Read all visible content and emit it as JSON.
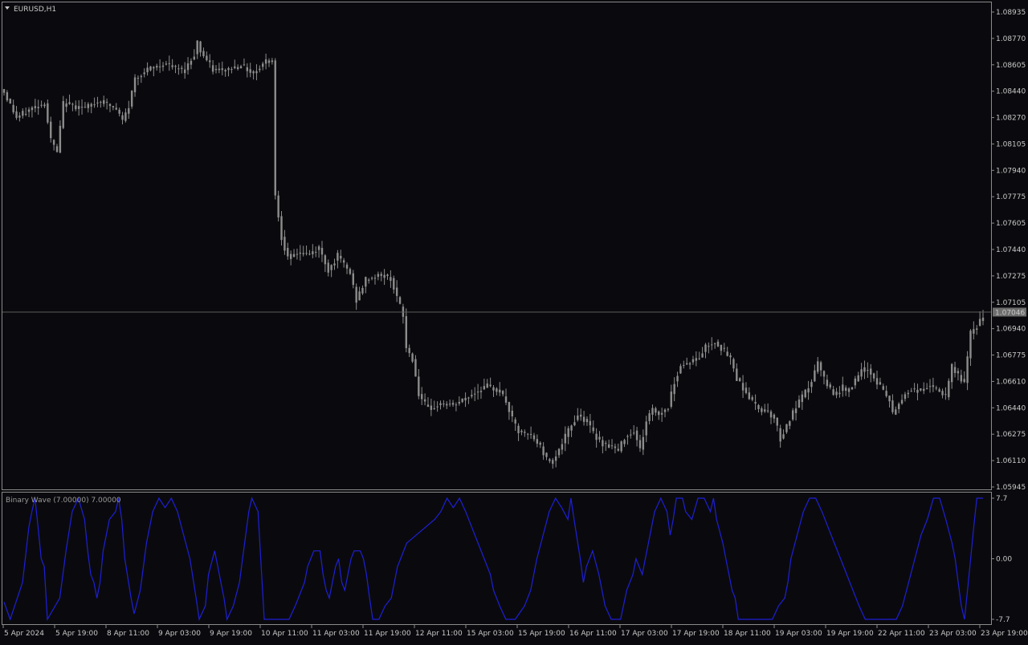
{
  "symbol": "EURUSD,H1",
  "colors": {
    "background": "#0a0a0e",
    "frame": "#8a8a8a",
    "candle": "#8c8c8c",
    "current_price_line": "#5a5a5a",
    "indicator_line": "#1f1fd8",
    "price_tag_bg": "#6e6e6e",
    "price_tag_text": "#0a0a0e"
  },
  "price_axis": {
    "ticks": [
      "1.08935",
      "1.08770",
      "1.08605",
      "1.08440",
      "1.08270",
      "1.08105",
      "1.07940",
      "1.07775",
      "1.07605",
      "1.07440",
      "1.07275",
      "1.07105",
      "1.06940",
      "1.06775",
      "1.06610",
      "1.06440",
      "1.06275",
      "1.06110",
      "1.05945"
    ],
    "range": [
      1.05945,
      1.08935
    ],
    "current_price": "1.07046"
  },
  "indicator": {
    "label": "Binary Wave (7.00000) 7.00000",
    "ticks": [
      "7.7",
      "0.00",
      "-7.7"
    ],
    "range": [
      -7.7,
      7.7
    ]
  },
  "time_axis": {
    "labels": [
      "5 Apr 2024",
      "5 Apr 19:00",
      "8 Apr 11:00",
      "9 Apr 03:00",
      "9 Apr 19:00",
      "10 Apr 11:00",
      "11 Apr 03:00",
      "11 Apr 19:00",
      "12 Apr 11:00",
      "15 Apr 03:00",
      "15 Apr 19:00",
      "16 Apr 11:00",
      "17 Apr 03:00",
      "17 Apr 19:00",
      "18 Apr 11:00",
      "19 Apr 03:00",
      "19 Apr 19:00",
      "22 Apr 11:00",
      "23 Apr 03:00",
      "23 Apr 19:00"
    ]
  },
  "chart_data": [
    {
      "type": "candlestick",
      "title": "EURUSD,H1",
      "ylim": [
        1.05945,
        1.08935
      ],
      "close_path": [
        [
          0,
          1.0843
        ],
        [
          4,
          1.0827
        ],
        [
          9,
          1.0833
        ],
        [
          13,
          1.0836
        ],
        [
          15,
          1.0813
        ],
        [
          17,
          1.0805
        ],
        [
          19,
          1.0836
        ],
        [
          26,
          1.0833
        ],
        [
          31,
          1.0838
        ],
        [
          36,
          1.0832
        ],
        [
          38,
          1.0825
        ],
        [
          40,
          1.0834
        ],
        [
          42,
          1.0852
        ],
        [
          47,
          1.0858
        ],
        [
          52,
          1.0861
        ],
        [
          55,
          1.0858
        ],
        [
          58,
          1.0857
        ],
        [
          61,
          1.0867
        ],
        [
          62,
          1.0875
        ],
        [
          63,
          1.0869
        ],
        [
          67,
          1.0857
        ],
        [
          71,
          1.0857
        ],
        [
          76,
          1.086
        ],
        [
          80,
          1.0855
        ],
        [
          84,
          1.0863
        ],
        [
          86,
          1.0863
        ],
        [
          87,
          1.0778
        ],
        [
          89,
          1.0752
        ],
        [
          91,
          1.0738
        ],
        [
          94,
          1.0742
        ],
        [
          98,
          1.0741
        ],
        [
          101,
          1.0745
        ],
        [
          104,
          1.0731
        ],
        [
          107,
          1.074
        ],
        [
          111,
          1.0729
        ],
        [
          113,
          1.0712
        ],
        [
          116,
          1.0725
        ],
        [
          121,
          1.0728
        ],
        [
          124,
          1.0726
        ],
        [
          126,
          1.0714
        ],
        [
          128,
          1.0702
        ],
        [
          129,
          1.0682
        ],
        [
          131,
          1.0675
        ],
        [
          133,
          1.0653
        ],
        [
          136,
          1.0643
        ],
        [
          140,
          1.0647
        ],
        [
          144,
          1.0646
        ],
        [
          147,
          1.0649
        ],
        [
          151,
          1.0654
        ],
        [
          155,
          1.0658
        ],
        [
          159,
          1.0655
        ],
        [
          161,
          1.0648
        ],
        [
          163,
          1.0637
        ],
        [
          165,
          1.0629
        ],
        [
          169,
          1.0627
        ],
        [
          172,
          1.062
        ],
        [
          174,
          1.0612
        ],
        [
          176,
          1.0611
        ],
        [
          178,
          1.0618
        ],
        [
          181,
          1.063
        ],
        [
          184,
          1.064
        ],
        [
          187,
          1.0636
        ],
        [
          189,
          1.0628
        ],
        [
          192,
          1.0622
        ],
        [
          195,
          1.062
        ],
        [
          197,
          1.0617
        ],
        [
          199,
          1.0626
        ],
        [
          202,
          1.063
        ],
        [
          204,
          1.0618
        ],
        [
          206,
          1.0636
        ],
        [
          208,
          1.0644
        ],
        [
          210,
          1.064
        ],
        [
          213,
          1.0645
        ],
        [
          215,
          1.0661
        ],
        [
          217,
          1.0671
        ],
        [
          220,
          1.0673
        ],
        [
          223,
          1.0676
        ],
        [
          225,
          1.0683
        ],
        [
          228,
          1.0686
        ],
        [
          230,
          1.0682
        ],
        [
          233,
          1.0675
        ],
        [
          235,
          1.0663
        ],
        [
          238,
          1.0654
        ],
        [
          240,
          1.0648
        ],
        [
          242,
          1.0644
        ],
        [
          245,
          1.0642
        ],
        [
          247,
          1.0638
        ],
        [
          249,
          1.0625
        ],
        [
          251,
          1.0633
        ],
        [
          253,
          1.0641
        ],
        [
          255,
          1.0648
        ],
        [
          257,
          1.0654
        ],
        [
          259,
          1.0661
        ],
        [
          261,
          1.0673
        ],
        [
          263,
          1.0662
        ],
        [
          265,
          1.0656
        ],
        [
          267,
          1.0653
        ],
        [
          269,
          1.0657
        ],
        [
          271,
          1.0656
        ],
        [
          273,
          1.0661
        ],
        [
          275,
          1.0667
        ],
        [
          277,
          1.0669
        ],
        [
          279,
          1.0663
        ],
        [
          281,
          1.0658
        ],
        [
          284,
          1.0649
        ],
        [
          285,
          1.064
        ],
        [
          287,
          1.0647
        ],
        [
          289,
          1.0653
        ],
        [
          291,
          1.0656
        ],
        [
          294,
          1.0655
        ],
        [
          296,
          1.0658
        ],
        [
          298,
          1.0657
        ],
        [
          300,
          1.0655
        ],
        [
          302,
          1.0651
        ],
        [
          304,
          1.067
        ],
        [
          306,
          1.0665
        ],
        [
          308,
          1.066
        ],
        [
          310,
          1.0691
        ],
        [
          312,
          1.0696
        ],
        [
          314,
          1.0702
        ]
      ]
    },
    {
      "type": "line",
      "title": "Binary Wave (7.00000) 7.00000",
      "ylim": [
        -7.7,
        7.7
      ],
      "points": [
        [
          0,
          -5.5
        ],
        [
          2,
          -7.7
        ],
        [
          6,
          -3
        ],
        [
          8,
          4
        ],
        [
          9,
          6
        ],
        [
          10,
          7.7
        ],
        [
          11,
          4
        ],
        [
          12,
          0
        ],
        [
          13,
          -1
        ],
        [
          14,
          -7.7
        ],
        [
          18,
          -5
        ],
        [
          20,
          1
        ],
        [
          22,
          6
        ],
        [
          24,
          7.7
        ],
        [
          26,
          5
        ],
        [
          27,
          1
        ],
        [
          28,
          -2
        ],
        [
          29,
          -3
        ],
        [
          30,
          -5
        ],
        [
          31,
          -3
        ],
        [
          32,
          1
        ],
        [
          34,
          5
        ],
        [
          36,
          6
        ],
        [
          37,
          7.7
        ],
        [
          38,
          5
        ],
        [
          39,
          0
        ],
        [
          41,
          -5
        ],
        [
          42,
          -7
        ],
        [
          44,
          -4
        ],
        [
          46,
          2
        ],
        [
          48,
          6
        ],
        [
          50,
          7.7
        ],
        [
          52,
          6.5
        ],
        [
          54,
          7.7
        ],
        [
          56,
          6
        ],
        [
          58,
          3
        ],
        [
          60,
          0
        ],
        [
          62,
          -5
        ],
        [
          63,
          -7.7
        ],
        [
          65,
          -6
        ],
        [
          66,
          -2
        ],
        [
          68,
          1
        ],
        [
          69,
          -1
        ],
        [
          70,
          -3
        ],
        [
          71,
          -5
        ],
        [
          72,
          -7.7
        ],
        [
          74,
          -6
        ],
        [
          76,
          -3
        ],
        [
          77,
          0
        ],
        [
          78,
          3
        ],
        [
          79,
          6
        ],
        [
          80,
          7.7
        ],
        [
          82,
          6
        ],
        [
          83,
          -1
        ],
        [
          84,
          -7.7
        ],
        [
          92,
          -7.7
        ],
        [
          94,
          -6
        ],
        [
          95,
          -5
        ],
        [
          97,
          -3
        ],
        [
          98,
          -1
        ],
        [
          99,
          0
        ],
        [
          100,
          1
        ],
        [
          102,
          1
        ],
        [
          103,
          -2
        ],
        [
          104,
          -4
        ],
        [
          105,
          -5
        ],
        [
          106,
          -3
        ],
        [
          107,
          -1
        ],
        [
          108,
          0
        ],
        [
          109,
          -3
        ],
        [
          110,
          -4
        ],
        [
          111,
          -2
        ],
        [
          112,
          0
        ],
        [
          113,
          1
        ],
        [
          115,
          1
        ],
        [
          116,
          0
        ],
        [
          117,
          -2
        ],
        [
          118,
          -5
        ],
        [
          119,
          -7.7
        ],
        [
          121,
          -7.7
        ],
        [
          123,
          -6
        ],
        [
          125,
          -5
        ],
        [
          126,
          -3
        ],
        [
          127,
          -1
        ],
        [
          128,
          0
        ],
        [
          130,
          2
        ],
        [
          133,
          3
        ],
        [
          136,
          4
        ],
        [
          139,
          5
        ],
        [
          141,
          6
        ],
        [
          143,
          7.7
        ],
        [
          145,
          6.5
        ],
        [
          147,
          7.7
        ],
        [
          149,
          6
        ],
        [
          151,
          4
        ],
        [
          153,
          2
        ],
        [
          155,
          0
        ],
        [
          157,
          -2
        ],
        [
          158,
          -4
        ],
        [
          160,
          -6
        ],
        [
          162,
          -7.7
        ],
        [
          165,
          -7.7
        ],
        [
          168,
          -6
        ],
        [
          170,
          -4
        ],
        [
          171,
          -2
        ],
        [
          172,
          0
        ],
        [
          174,
          3
        ],
        [
          176,
          6
        ],
        [
          178,
          7.7
        ],
        [
          180,
          6.5
        ],
        [
          182,
          5
        ],
        [
          183,
          7.7
        ],
        [
          184,
          5
        ],
        [
          186,
          0
        ],
        [
          187,
          -3
        ],
        [
          188,
          -1
        ],
        [
          190,
          1
        ],
        [
          192,
          -2
        ],
        [
          194,
          -6
        ],
        [
          196,
          -7.7
        ],
        [
          199,
          -7.7
        ],
        [
          201,
          -4
        ],
        [
          203,
          -2
        ],
        [
          204,
          0
        ],
        [
          205,
          -1
        ],
        [
          206,
          -2
        ],
        [
          207,
          0
        ],
        [
          208,
          2
        ],
        [
          209,
          4
        ],
        [
          210,
          6
        ],
        [
          212,
          7.7
        ],
        [
          214,
          6
        ],
        [
          215,
          3
        ],
        [
          216,
          5
        ],
        [
          217,
          7.7
        ],
        [
          219,
          7.7
        ],
        [
          220,
          6
        ],
        [
          222,
          5
        ],
        [
          224,
          7.7
        ],
        [
          226,
          7.7
        ],
        [
          228,
          6
        ],
        [
          229,
          7.7
        ],
        [
          230,
          5
        ],
        [
          232,
          2
        ],
        [
          233,
          0
        ],
        [
          234,
          -2
        ],
        [
          235,
          -4
        ],
        [
          236,
          -5
        ],
        [
          237,
          -7.7
        ],
        [
          248,
          -7.7
        ],
        [
          250,
          -6
        ],
        [
          252,
          -5
        ],
        [
          253,
          -3
        ],
        [
          254,
          0
        ],
        [
          256,
          3
        ],
        [
          258,
          6
        ],
        [
          260,
          7.7
        ],
        [
          262,
          7.7
        ],
        [
          264,
          6
        ],
        [
          266,
          4
        ],
        [
          268,
          2
        ],
        [
          270,
          0
        ],
        [
          272,
          -2
        ],
        [
          274,
          -4
        ],
        [
          276,
          -6
        ],
        [
          278,
          -7.7
        ],
        [
          288,
          -7.7
        ],
        [
          290,
          -6
        ],
        [
          292,
          -3
        ],
        [
          294,
          0
        ],
        [
          296,
          3
        ],
        [
          298,
          5
        ],
        [
          300,
          7.7
        ],
        [
          302,
          7.7
        ],
        [
          304,
          5
        ],
        [
          306,
          2
        ],
        [
          307,
          0
        ],
        [
          308,
          -3
        ],
        [
          309,
          -6
        ],
        [
          310,
          -7.7
        ],
        [
          311,
          -4
        ],
        [
          312,
          0
        ],
        [
          313,
          4
        ],
        [
          314,
          7.7
        ],
        [
          316,
          7.7
        ]
      ]
    }
  ]
}
